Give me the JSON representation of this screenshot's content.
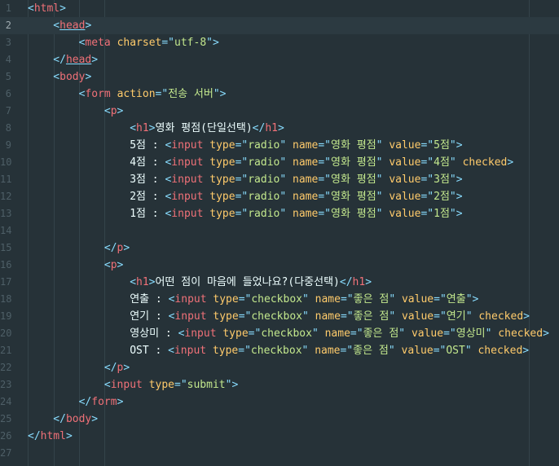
{
  "editor": {
    "active_line": 2,
    "lines": [
      {
        "n": "1",
        "indent": 0,
        "tokens": [
          {
            "c": "p",
            "v": "<"
          },
          {
            "c": "t",
            "v": "html"
          },
          {
            "c": "p",
            "v": ">"
          }
        ]
      },
      {
        "n": "2",
        "indent": 1,
        "tokens": [
          {
            "c": "p",
            "v": "<"
          },
          {
            "c": "tu",
            "v": "head"
          },
          {
            "c": "p",
            "v": ">"
          }
        ]
      },
      {
        "n": "3",
        "indent": 2,
        "tokens": [
          {
            "c": "p",
            "v": "<"
          },
          {
            "c": "t",
            "v": "meta"
          },
          {
            "c": "x",
            "v": " "
          },
          {
            "c": "a",
            "v": "charset"
          },
          {
            "c": "p",
            "v": "=\""
          },
          {
            "c": "s",
            "v": "utf-8"
          },
          {
            "c": "p",
            "v": "\">"
          }
        ]
      },
      {
        "n": "4",
        "indent": 1,
        "tokens": [
          {
            "c": "p",
            "v": "</"
          },
          {
            "c": "tu",
            "v": "head"
          },
          {
            "c": "p",
            "v": ">"
          }
        ]
      },
      {
        "n": "5",
        "indent": 1,
        "tokens": [
          {
            "c": "p",
            "v": "<"
          },
          {
            "c": "t",
            "v": "body"
          },
          {
            "c": "p",
            "v": ">"
          }
        ]
      },
      {
        "n": "6",
        "indent": 2,
        "tokens": [
          {
            "c": "p",
            "v": "<"
          },
          {
            "c": "t",
            "v": "form"
          },
          {
            "c": "x",
            "v": " "
          },
          {
            "c": "a",
            "v": "action"
          },
          {
            "c": "p",
            "v": "=\""
          },
          {
            "c": "s",
            "v": "전송 서버"
          },
          {
            "c": "p",
            "v": "\">"
          }
        ]
      },
      {
        "n": "7",
        "indent": 3,
        "tokens": [
          {
            "c": "p",
            "v": "<"
          },
          {
            "c": "t",
            "v": "p"
          },
          {
            "c": "p",
            "v": ">"
          }
        ]
      },
      {
        "n": "8",
        "indent": 4,
        "tokens": [
          {
            "c": "p",
            "v": "<"
          },
          {
            "c": "t",
            "v": "h1"
          },
          {
            "c": "p",
            "v": ">"
          },
          {
            "c": "x",
            "v": "영화 평점(단일선택)"
          },
          {
            "c": "p",
            "v": "</"
          },
          {
            "c": "t",
            "v": "h1"
          },
          {
            "c": "p",
            "v": ">"
          }
        ]
      },
      {
        "n": "9",
        "indent": 4,
        "tokens": [
          {
            "c": "x",
            "v": "5점 : "
          },
          {
            "c": "p",
            "v": "<"
          },
          {
            "c": "t",
            "v": "input"
          },
          {
            "c": "x",
            "v": " "
          },
          {
            "c": "a",
            "v": "type"
          },
          {
            "c": "p",
            "v": "=\""
          },
          {
            "c": "s",
            "v": "radio"
          },
          {
            "c": "p",
            "v": "\""
          },
          {
            "c": "x",
            "v": " "
          },
          {
            "c": "a",
            "v": "name"
          },
          {
            "c": "p",
            "v": "=\""
          },
          {
            "c": "s",
            "v": "영화 평점"
          },
          {
            "c": "p",
            "v": "\""
          },
          {
            "c": "x",
            "v": " "
          },
          {
            "c": "a",
            "v": "value"
          },
          {
            "c": "p",
            "v": "=\""
          },
          {
            "c": "s",
            "v": "5점"
          },
          {
            "c": "p",
            "v": "\">"
          }
        ]
      },
      {
        "n": "10",
        "indent": 4,
        "tokens": [
          {
            "c": "x",
            "v": "4점 : "
          },
          {
            "c": "p",
            "v": "<"
          },
          {
            "c": "t",
            "v": "input"
          },
          {
            "c": "x",
            "v": " "
          },
          {
            "c": "a",
            "v": "type"
          },
          {
            "c": "p",
            "v": "=\""
          },
          {
            "c": "s",
            "v": "radio"
          },
          {
            "c": "p",
            "v": "\""
          },
          {
            "c": "x",
            "v": " "
          },
          {
            "c": "a",
            "v": "name"
          },
          {
            "c": "p",
            "v": "=\""
          },
          {
            "c": "s",
            "v": "영화 평점"
          },
          {
            "c": "p",
            "v": "\""
          },
          {
            "c": "x",
            "v": " "
          },
          {
            "c": "a",
            "v": "value"
          },
          {
            "c": "p",
            "v": "=\""
          },
          {
            "c": "s",
            "v": "4점"
          },
          {
            "c": "p",
            "v": "\""
          },
          {
            "c": "x",
            "v": " "
          },
          {
            "c": "a",
            "v": "checked"
          },
          {
            "c": "p",
            "v": ">"
          }
        ]
      },
      {
        "n": "11",
        "indent": 4,
        "tokens": [
          {
            "c": "x",
            "v": "3점 : "
          },
          {
            "c": "p",
            "v": "<"
          },
          {
            "c": "t",
            "v": "input"
          },
          {
            "c": "x",
            "v": " "
          },
          {
            "c": "a",
            "v": "type"
          },
          {
            "c": "p",
            "v": "=\""
          },
          {
            "c": "s",
            "v": "radio"
          },
          {
            "c": "p",
            "v": "\""
          },
          {
            "c": "x",
            "v": " "
          },
          {
            "c": "a",
            "v": "name"
          },
          {
            "c": "p",
            "v": "=\""
          },
          {
            "c": "s",
            "v": "영화 평점"
          },
          {
            "c": "p",
            "v": "\""
          },
          {
            "c": "x",
            "v": " "
          },
          {
            "c": "a",
            "v": "value"
          },
          {
            "c": "p",
            "v": "=\""
          },
          {
            "c": "s",
            "v": "3점"
          },
          {
            "c": "p",
            "v": "\">"
          }
        ]
      },
      {
        "n": "12",
        "indent": 4,
        "tokens": [
          {
            "c": "x",
            "v": "2점 : "
          },
          {
            "c": "p",
            "v": "<"
          },
          {
            "c": "t",
            "v": "input"
          },
          {
            "c": "x",
            "v": " "
          },
          {
            "c": "a",
            "v": "type"
          },
          {
            "c": "p",
            "v": "=\""
          },
          {
            "c": "s",
            "v": "radio"
          },
          {
            "c": "p",
            "v": "\""
          },
          {
            "c": "x",
            "v": " "
          },
          {
            "c": "a",
            "v": "name"
          },
          {
            "c": "p",
            "v": "=\""
          },
          {
            "c": "s",
            "v": "영화 평점"
          },
          {
            "c": "p",
            "v": "\""
          },
          {
            "c": "x",
            "v": " "
          },
          {
            "c": "a",
            "v": "value"
          },
          {
            "c": "p",
            "v": "=\""
          },
          {
            "c": "s",
            "v": "2점"
          },
          {
            "c": "p",
            "v": "\">"
          }
        ]
      },
      {
        "n": "13",
        "indent": 4,
        "tokens": [
          {
            "c": "x",
            "v": "1점 : "
          },
          {
            "c": "p",
            "v": "<"
          },
          {
            "c": "t",
            "v": "input"
          },
          {
            "c": "x",
            "v": " "
          },
          {
            "c": "a",
            "v": "type"
          },
          {
            "c": "p",
            "v": "=\""
          },
          {
            "c": "s",
            "v": "radio"
          },
          {
            "c": "p",
            "v": "\""
          },
          {
            "c": "x",
            "v": " "
          },
          {
            "c": "a",
            "v": "name"
          },
          {
            "c": "p",
            "v": "=\""
          },
          {
            "c": "s",
            "v": "영화 평점"
          },
          {
            "c": "p",
            "v": "\""
          },
          {
            "c": "x",
            "v": " "
          },
          {
            "c": "a",
            "v": "value"
          },
          {
            "c": "p",
            "v": "=\""
          },
          {
            "c": "s",
            "v": "1점"
          },
          {
            "c": "p",
            "v": "\">"
          }
        ]
      },
      {
        "n": "14",
        "indent": 0,
        "tokens": []
      },
      {
        "n": "15",
        "indent": 3,
        "tokens": [
          {
            "c": "p",
            "v": "</"
          },
          {
            "c": "t",
            "v": "p"
          },
          {
            "c": "p",
            "v": ">"
          }
        ]
      },
      {
        "n": "16",
        "indent": 3,
        "tokens": [
          {
            "c": "p",
            "v": "<"
          },
          {
            "c": "t",
            "v": "p"
          },
          {
            "c": "p",
            "v": ">"
          }
        ]
      },
      {
        "n": "17",
        "indent": 4,
        "tokens": [
          {
            "c": "p",
            "v": "<"
          },
          {
            "c": "t",
            "v": "h1"
          },
          {
            "c": "p",
            "v": ">"
          },
          {
            "c": "x",
            "v": "어떤 점이 마음에 들었나요?(다중선택)"
          },
          {
            "c": "p",
            "v": "</"
          },
          {
            "c": "t",
            "v": "h1"
          },
          {
            "c": "p",
            "v": ">"
          }
        ]
      },
      {
        "n": "18",
        "indent": 4,
        "tokens": [
          {
            "c": "x",
            "v": "연출 : "
          },
          {
            "c": "p",
            "v": "<"
          },
          {
            "c": "t",
            "v": "input"
          },
          {
            "c": "x",
            "v": " "
          },
          {
            "c": "a",
            "v": "type"
          },
          {
            "c": "p",
            "v": "=\""
          },
          {
            "c": "s",
            "v": "checkbox"
          },
          {
            "c": "p",
            "v": "\""
          },
          {
            "c": "x",
            "v": " "
          },
          {
            "c": "a",
            "v": "name"
          },
          {
            "c": "p",
            "v": "=\""
          },
          {
            "c": "s",
            "v": "좋은 점"
          },
          {
            "c": "p",
            "v": "\""
          },
          {
            "c": "x",
            "v": " "
          },
          {
            "c": "a",
            "v": "value"
          },
          {
            "c": "p",
            "v": "=\""
          },
          {
            "c": "s",
            "v": "연출"
          },
          {
            "c": "p",
            "v": "\">"
          }
        ]
      },
      {
        "n": "19",
        "indent": 4,
        "tokens": [
          {
            "c": "x",
            "v": "연기 : "
          },
          {
            "c": "p",
            "v": "<"
          },
          {
            "c": "t",
            "v": "input"
          },
          {
            "c": "x",
            "v": " "
          },
          {
            "c": "a",
            "v": "type"
          },
          {
            "c": "p",
            "v": "=\""
          },
          {
            "c": "s",
            "v": "checkbox"
          },
          {
            "c": "p",
            "v": "\""
          },
          {
            "c": "x",
            "v": " "
          },
          {
            "c": "a",
            "v": "name"
          },
          {
            "c": "p",
            "v": "=\""
          },
          {
            "c": "s",
            "v": "좋은 점"
          },
          {
            "c": "p",
            "v": "\""
          },
          {
            "c": "x",
            "v": " "
          },
          {
            "c": "a",
            "v": "value"
          },
          {
            "c": "p",
            "v": "=\""
          },
          {
            "c": "s",
            "v": "연기"
          },
          {
            "c": "p",
            "v": "\""
          },
          {
            "c": "x",
            "v": " "
          },
          {
            "c": "a",
            "v": "checked"
          },
          {
            "c": "p",
            "v": ">"
          }
        ]
      },
      {
        "n": "20",
        "indent": 4,
        "tokens": [
          {
            "c": "x",
            "v": "영상미 : "
          },
          {
            "c": "p",
            "v": "<"
          },
          {
            "c": "t",
            "v": "input"
          },
          {
            "c": "x",
            "v": " "
          },
          {
            "c": "a",
            "v": "type"
          },
          {
            "c": "p",
            "v": "=\""
          },
          {
            "c": "s",
            "v": "checkbox"
          },
          {
            "c": "p",
            "v": "\""
          },
          {
            "c": "x",
            "v": " "
          },
          {
            "c": "a",
            "v": "name"
          },
          {
            "c": "p",
            "v": "=\""
          },
          {
            "c": "s",
            "v": "좋은 점"
          },
          {
            "c": "p",
            "v": "\""
          },
          {
            "c": "x",
            "v": " "
          },
          {
            "c": "a",
            "v": "value"
          },
          {
            "c": "p",
            "v": "=\""
          },
          {
            "c": "s",
            "v": "영상미"
          },
          {
            "c": "p",
            "v": "\""
          },
          {
            "c": "x",
            "v": " "
          },
          {
            "c": "a",
            "v": "checked"
          },
          {
            "c": "p",
            "v": ">"
          }
        ]
      },
      {
        "n": "21",
        "indent": 4,
        "tokens": [
          {
            "c": "x",
            "v": "OST : "
          },
          {
            "c": "p",
            "v": "<"
          },
          {
            "c": "t",
            "v": "input"
          },
          {
            "c": "x",
            "v": " "
          },
          {
            "c": "a",
            "v": "type"
          },
          {
            "c": "p",
            "v": "=\""
          },
          {
            "c": "s",
            "v": "checkbox"
          },
          {
            "c": "p",
            "v": "\""
          },
          {
            "c": "x",
            "v": " "
          },
          {
            "c": "a",
            "v": "name"
          },
          {
            "c": "p",
            "v": "=\""
          },
          {
            "c": "s",
            "v": "좋은 점"
          },
          {
            "c": "p",
            "v": "\""
          },
          {
            "c": "x",
            "v": " "
          },
          {
            "c": "a",
            "v": "value"
          },
          {
            "c": "p",
            "v": "=\""
          },
          {
            "c": "s",
            "v": "OST"
          },
          {
            "c": "p",
            "v": "\""
          },
          {
            "c": "x",
            "v": " "
          },
          {
            "c": "a",
            "v": "checked"
          },
          {
            "c": "p",
            "v": ">"
          }
        ]
      },
      {
        "n": "22",
        "indent": 3,
        "tokens": [
          {
            "c": "p",
            "v": "</"
          },
          {
            "c": "t",
            "v": "p"
          },
          {
            "c": "p",
            "v": ">"
          }
        ]
      },
      {
        "n": "23",
        "indent": 3,
        "tokens": [
          {
            "c": "p",
            "v": "<"
          },
          {
            "c": "t",
            "v": "input"
          },
          {
            "c": "x",
            "v": " "
          },
          {
            "c": "a",
            "v": "type"
          },
          {
            "c": "p",
            "v": "=\""
          },
          {
            "c": "s",
            "v": "submit"
          },
          {
            "c": "p",
            "v": "\">"
          }
        ]
      },
      {
        "n": "24",
        "indent": 2,
        "tokens": [
          {
            "c": "p",
            "v": "</"
          },
          {
            "c": "t",
            "v": "form"
          },
          {
            "c": "p",
            "v": ">"
          }
        ]
      },
      {
        "n": "25",
        "indent": 1,
        "tokens": [
          {
            "c": "p",
            "v": "</"
          },
          {
            "c": "t",
            "v": "body"
          },
          {
            "c": "p",
            "v": ">"
          }
        ]
      },
      {
        "n": "26",
        "indent": 0,
        "tokens": [
          {
            "c": "p",
            "v": "</"
          },
          {
            "c": "t",
            "v": "html"
          },
          {
            "c": "p",
            "v": ">"
          }
        ]
      },
      {
        "n": "27",
        "indent": 0,
        "tokens": []
      }
    ]
  },
  "theme": {
    "background": "#263238",
    "tag": "#f07178",
    "punctuation": "#89ddff",
    "attribute": "#ffcb6b",
    "string": "#c3e88d",
    "text": "#eeffff"
  }
}
